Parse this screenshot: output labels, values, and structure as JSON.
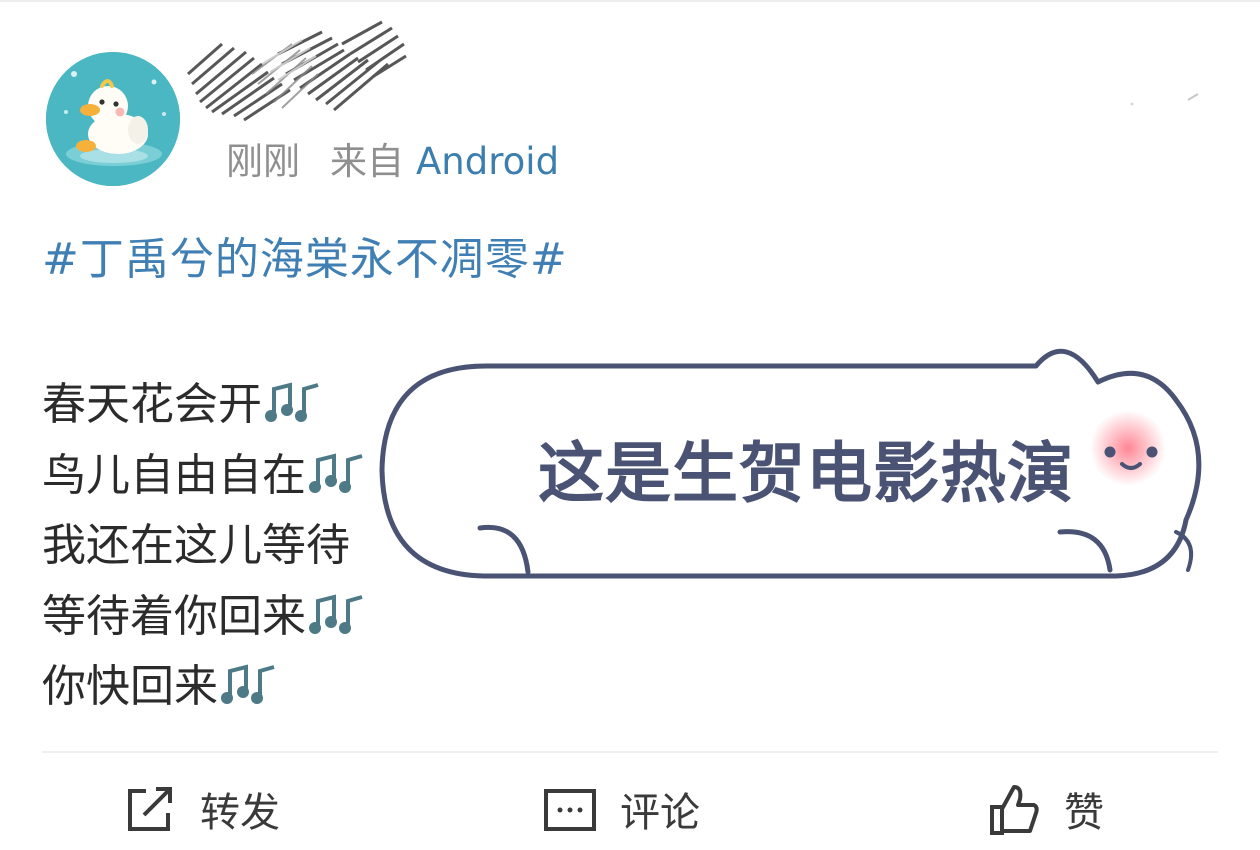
{
  "post": {
    "time": "刚刚",
    "source_prefix": "来自",
    "source_name": "Android",
    "hashtag": "#丁禹兮的海棠永不凋零#",
    "lyrics": [
      "春天花会开",
      "鸟儿自由自在",
      "我还在这儿等待",
      "等待着你回来",
      "你快回来"
    ],
    "lyric_icon": "music-notes-icon"
  },
  "sticker": {
    "text": "这是生贺电影热演"
  },
  "actions": {
    "repost_label": "转发",
    "comment_label": "评论",
    "like_label": "赞"
  },
  "colors": {
    "link_blue": "#3f7fb3",
    "meta_gray": "#8f8f8f",
    "avatar_teal": "#4bb7c2",
    "sticker_text": "#4a5374"
  }
}
